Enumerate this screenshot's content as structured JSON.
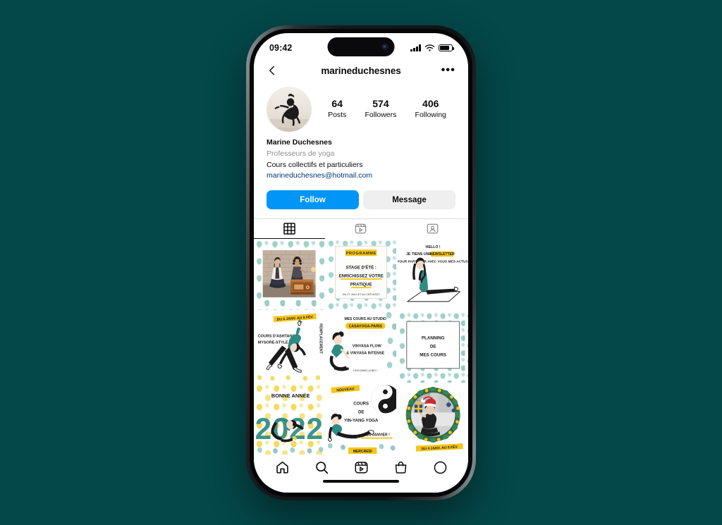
{
  "background_color": "#04484a",
  "device": {
    "status_bar": {
      "time": "09:42",
      "signal_icon": "cellular-signal-icon",
      "wifi_icon": "wifi-icon",
      "battery_icon": "battery-icon"
    }
  },
  "nav": {
    "back_icon": "back-chevron-icon",
    "username": "marineduchesnes",
    "more_icon": "more-options-icon",
    "more_label": "•••"
  },
  "profile": {
    "avatar_alt": "profile-avatar",
    "stats": [
      {
        "number": "64",
        "label": "Posts"
      },
      {
        "number": "574",
        "label": "Followers"
      },
      {
        "number": "406",
        "label": "Following"
      }
    ],
    "name": "Marine Duchesnes",
    "category": "Professeurs de yoga",
    "description": "Cours collectifs et particuliers",
    "email": "marineduchesnes@hotmail.com",
    "follow_label": "Follow",
    "message_label": "Message",
    "follow_color": "#0095f6",
    "message_color": "#efefef"
  },
  "tabs": [
    {
      "name": "grid-tab",
      "icon": "grid-icon",
      "active": true
    },
    {
      "name": "reels-tab",
      "icon": "reels-icon",
      "active": false
    },
    {
      "name": "tagged-tab",
      "icon": "tagged-icon",
      "active": false
    }
  ],
  "posts": [
    {
      "id": "post-1",
      "type": "photo-ginkgo-frame",
      "description": "Two women seated beside a vintage radio, brick wall, teal ginkgo leaf border"
    },
    {
      "id": "post-2",
      "type": "text-card",
      "badge": "PROGRAMME",
      "lines": [
        "STAGE D'ÉTÉ :",
        "ENRICHISSEZ VOTRE",
        "PRATIQUE"
      ],
      "footer": "DU 27 JUILLET AU 1ER AOÛT"
    },
    {
      "id": "post-3",
      "type": "illustration-text",
      "lines": [
        "HELLO !",
        "JE TIENS UNE",
        "POUR PARTAGER AVEC VOUS MES ACTUS."
      ],
      "highlight": "NEWSLETTER"
    },
    {
      "id": "post-4",
      "type": "illustration-text",
      "badge": "DU 4 JANV. AU 8 FÉV",
      "lines": [
        "COURS D'ASHTANGA",
        "MYSORE-STYLE"
      ],
      "vertical_text": "REMPLACEMENT"
    },
    {
      "id": "post-5",
      "type": "illustration-text",
      "lines": [
        "MES COURS AU STUDIO",
        "VINYASA FLOW",
        "& VINYASA INTENSE"
      ],
      "badge": "CASAYOGA-PARIS",
      "footer": "LOIN DANS LA BIO !"
    },
    {
      "id": "post-6",
      "type": "text-card-ginkgo",
      "lines": [
        "PLANNING",
        "DE",
        "MES COURS"
      ]
    },
    {
      "id": "post-7",
      "type": "illustration-year",
      "lines": [
        "BONNE ANNÉE"
      ],
      "year": "2022"
    },
    {
      "id": "post-8",
      "type": "illustration-text",
      "badge": "NOUVEAU",
      "lines": [
        "COURS",
        "DE",
        "YIN-YANG YOGA"
      ],
      "footer": "DÈS JANVIER !",
      "symbol": "yin-yang-icon"
    },
    {
      "id": "post-9",
      "type": "photo-wreath",
      "description": "Woman with Santa hat holding a gift inside a Christmas wreath",
      "badge": "DU 4 JANV. AU 8 FÉV"
    }
  ],
  "bottom_nav": [
    {
      "name": "bottom-nav-home",
      "icon": "home-icon"
    },
    {
      "name": "bottom-nav-search",
      "icon": "search-icon"
    },
    {
      "name": "bottom-nav-reels",
      "icon": "reels-icon"
    },
    {
      "name": "bottom-nav-shop",
      "icon": "shop-icon"
    },
    {
      "name": "bottom-nav-profile",
      "icon": "profile-circle-icon"
    }
  ],
  "colors": {
    "teal": "#2e8b84",
    "yellow": "#f5c518",
    "ink": "#1a1a1a",
    "leaf_teal": "#7fc4bd",
    "leaf_yellow": "#f3d64b"
  }
}
